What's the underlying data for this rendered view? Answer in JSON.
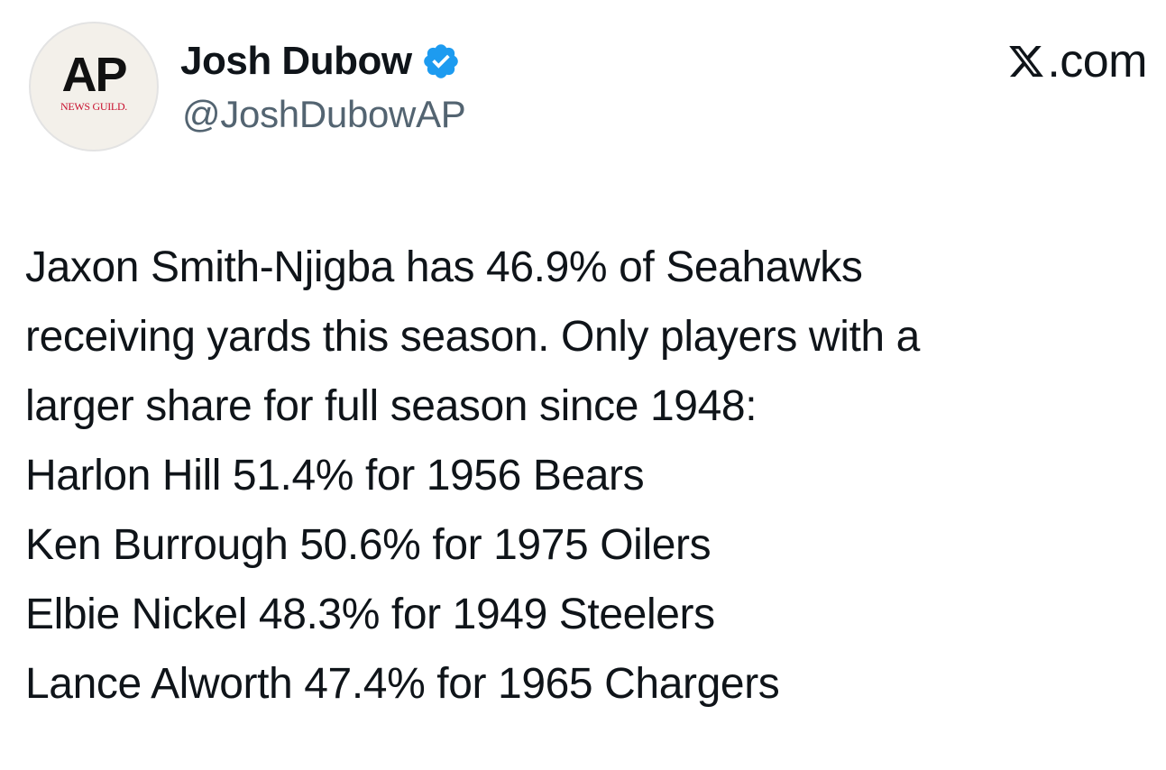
{
  "author": {
    "avatar_text": "AP",
    "avatar_subtext": "NEWS GUILD.",
    "display_name": "Josh Dubow",
    "verified_icon": "verified-badge-icon",
    "handle": "@JoshDubowAP"
  },
  "brand": {
    "text": ".com",
    "icon": "x-logo-icon"
  },
  "tweet": {
    "lines": [
      "Jaxon Smith-Njigba has 46.9% of Seahawks",
      "receiving yards this season. Only players with a",
      "larger share for full season since 1948:",
      "Harlon Hill 51.4% for 1956 Bears",
      "Ken Burrough 50.6% for 1975 Oilers",
      "Elbie Nickel 48.3% for 1949 Steelers",
      "Lance Alworth 47.4% for 1965 Chargers"
    ]
  },
  "colors": {
    "text": "#0f1419",
    "secondary_text": "#536471",
    "verified_blue": "#1d9bf0",
    "avatar_red": "#c8102e"
  }
}
